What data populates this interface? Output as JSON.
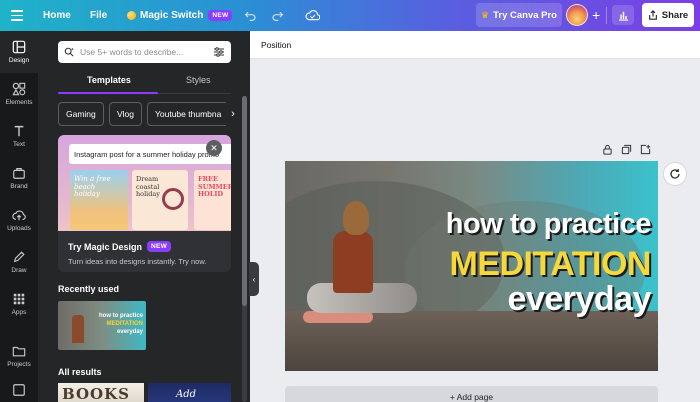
{
  "topbar": {
    "home": "Home",
    "file": "File",
    "magic_switch": "Magic Switch",
    "magic_badge": "NEW",
    "try_pro": "Try Canva Pro",
    "share": "Share",
    "gradient_colors": [
      "#1fb3c8",
      "#2b8fd4",
      "#5a5ee0",
      "#7b3fe4"
    ]
  },
  "rail": {
    "items": [
      {
        "label": "Design",
        "icon": "design-icon",
        "active": true
      },
      {
        "label": "Elements",
        "icon": "elements-icon"
      },
      {
        "label": "Text",
        "icon": "text-icon"
      },
      {
        "label": "Brand",
        "icon": "brand-icon"
      },
      {
        "label": "Uploads",
        "icon": "uploads-icon"
      },
      {
        "label": "Draw",
        "icon": "draw-icon"
      },
      {
        "label": "Apps",
        "icon": "apps-icon"
      },
      {
        "label": "Projects",
        "icon": "projects-icon"
      }
    ]
  },
  "panel": {
    "search_placeholder": "Use 5+ words to describe...",
    "tabs": [
      "Templates",
      "Styles"
    ],
    "chips": [
      "Gaming",
      "Vlog",
      "Youtube thumbna"
    ],
    "magic_design": {
      "prompt": "Instagram post for a summer holiday promo",
      "thumb1": "Win a free beach holiday",
      "thumb2": "Dream coastal holiday",
      "thumb3": "FREE SUMMER HOLID",
      "title": "Try Magic Design",
      "badge": "NEW",
      "subtitle": "Turn ideas into designs instantly. Try now."
    },
    "recently_used": "Recently used",
    "recent_thumb": {
      "line1": "how to practice",
      "line2": "MEDITATION",
      "line3": "everyday"
    },
    "all_results": "All results",
    "result1": "BOOKS",
    "result2": "Add"
  },
  "workspace": {
    "position_label": "Position",
    "add_page": "+ Add page"
  },
  "canvas": {
    "line1": "how to practice",
    "line2": "MEDITATION",
    "line3": "everyday",
    "accent_color": "#f6d83a"
  }
}
